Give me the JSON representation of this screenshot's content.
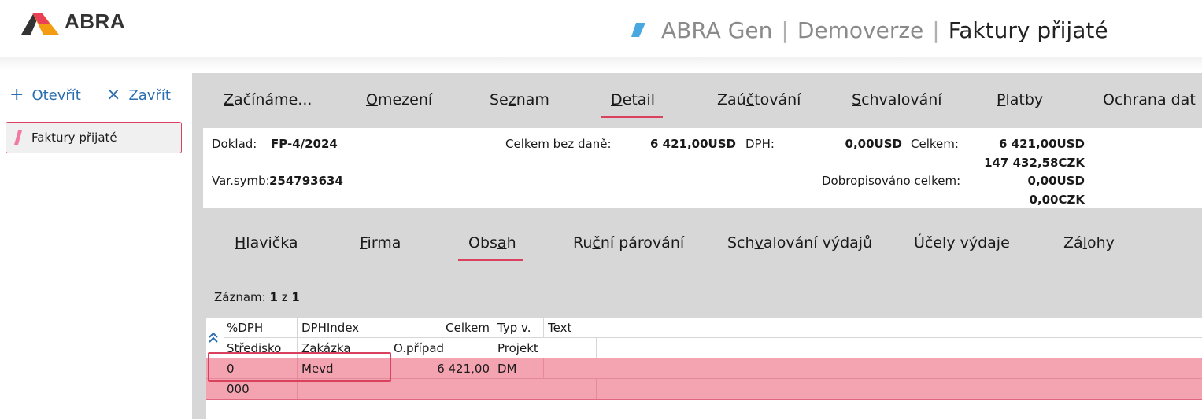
{
  "header": {
    "brand": "ABRA",
    "app": "ABRA Gen",
    "database": "Demoverze",
    "agenda": "Faktury přijaté",
    "accent_color": "#4aa8e0",
    "logo_colors": [
      "#e94057",
      "#f39c12",
      "#333333"
    ]
  },
  "sidebar": {
    "open_label": "Otevřít",
    "close_label": "Zavřít",
    "open_icon": "plus-icon",
    "close_icon": "close-icon",
    "doc_label": "Faktury přijaté",
    "doc_accent_color": "#f07ba0"
  },
  "tabs": [
    {
      "pre": "",
      "ul": "Z",
      "post": "ačínáme..."
    },
    {
      "pre": "",
      "ul": "O",
      "post": "mezení"
    },
    {
      "pre": "Se",
      "ul": "z",
      "post": "nam"
    },
    {
      "pre": "",
      "ul": "D",
      "post": "etail"
    },
    {
      "pre": "Zaú",
      "ul": "č",
      "post": "tování"
    },
    {
      "pre": "",
      "ul": "S",
      "post": "chvalování"
    },
    {
      "pre": "",
      "ul": "P",
      "post": "latby"
    },
    {
      "pre": "Ochrana dat",
      "ul": "",
      "post": ""
    }
  ],
  "active_tab": "Detail",
  "info": {
    "doklad_label": "Doklad:",
    "doklad_value": "FP-4/2024",
    "celkem_bez_dane_label": "Celkem bez daně:",
    "celkem_bez_dane_value": "6 421,00USD",
    "dph_label": "DPH:",
    "dph_value": "0,00USD",
    "celkem_label": "Celkem:",
    "celkem_value_usd": "6 421,00USD",
    "celkem_value_czk": "147 432,58CZK",
    "varsymb_label": "Var.symb:",
    "varsymb_value": "254793634",
    "dobropis_label": "Dobropisováno celkem:",
    "dobropis_value_usd": "0,00USD",
    "dobropis_value_czk": "0,00CZK"
  },
  "subtabs": [
    {
      "pre": "",
      "ul": "H",
      "post": "lavička"
    },
    {
      "pre": "",
      "ul": "F",
      "post": "irma"
    },
    {
      "pre": "Obs",
      "ul": "a",
      "post": "h"
    },
    {
      "pre": "Ru",
      "ul": "č",
      "post": "ní párování"
    },
    {
      "pre": "Sch",
      "ul": "v",
      "post": "alování výdajů"
    },
    {
      "pre": "Účely výdaje",
      "ul": "",
      "post": ""
    },
    {
      "pre": "Zá",
      "ul": "l",
      "post": "ohy"
    }
  ],
  "active_subtab": "Obsah",
  "grid": {
    "record_label": "Záznam:",
    "record_current": "1",
    "record_of": "z",
    "record_total": "1",
    "collapse_icon": "double-chevron-up-icon",
    "headers_row1": [
      "%DPH",
      "DPHIndex",
      "Celkem",
      "Typ v.",
      "Text"
    ],
    "headers_row2": [
      "Středisko",
      "Zakázka",
      "O.případ",
      "Projekt"
    ],
    "rows": [
      {
        "dph": "0",
        "dphindex": "Mevd",
        "celkem": "6 421,00",
        "typ": "DM",
        "text": "",
        "stredisko": "000",
        "zakazka": "",
        "opripad": "",
        "projekt": ""
      }
    ],
    "selected_row_color": "#f4a3b1"
  }
}
